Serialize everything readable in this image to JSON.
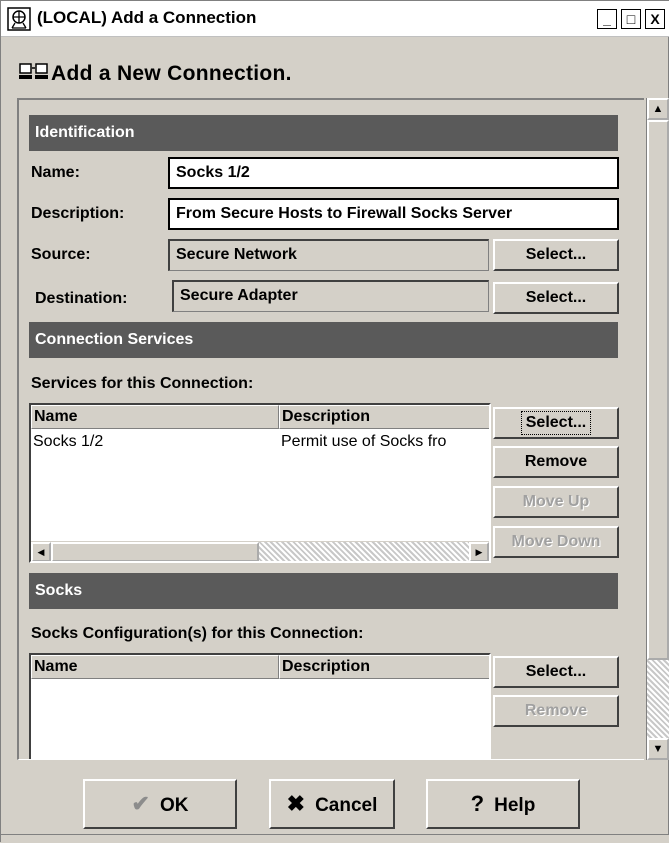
{
  "window": {
    "title": "(LOCAL) Add a Connection",
    "subtitle": "Add a New Connection.",
    "controls": [
      "_",
      "□",
      "X"
    ]
  },
  "identification": {
    "header": "Identification",
    "name_label": "Name:",
    "name_value": "Socks 1/2",
    "description_label": "Description:",
    "description_value": "From Secure Hosts to Firewall Socks Server",
    "source_label": "Source:",
    "source_value": "Secure Network",
    "destination_label": "Destination:",
    "destination_value": "Secure Adapter",
    "select_label": "Select..."
  },
  "connection_services": {
    "header": "Connection Services",
    "list_label": "Services for this Connection:",
    "columns": [
      "Name",
      "Description"
    ],
    "rows": [
      {
        "name": "Socks 1/2",
        "description": "Permit use of Socks fro"
      }
    ],
    "buttons": {
      "select": "Select...",
      "remove": "Remove",
      "move_up": "Move Up",
      "move_down": "Move Down"
    }
  },
  "socks": {
    "header": "Socks",
    "list_label": "Socks Configuration(s) for this Connection:",
    "columns": [
      "Name",
      "Description"
    ],
    "buttons": {
      "select": "Select...",
      "remove": "Remove"
    }
  },
  "footer": {
    "ok": "OK",
    "cancel": "Cancel",
    "help": "Help"
  },
  "colors": {
    "header_bg": "#5a5a5a",
    "face": "#d4d0c8",
    "ok_check": "#8c8c8c"
  }
}
